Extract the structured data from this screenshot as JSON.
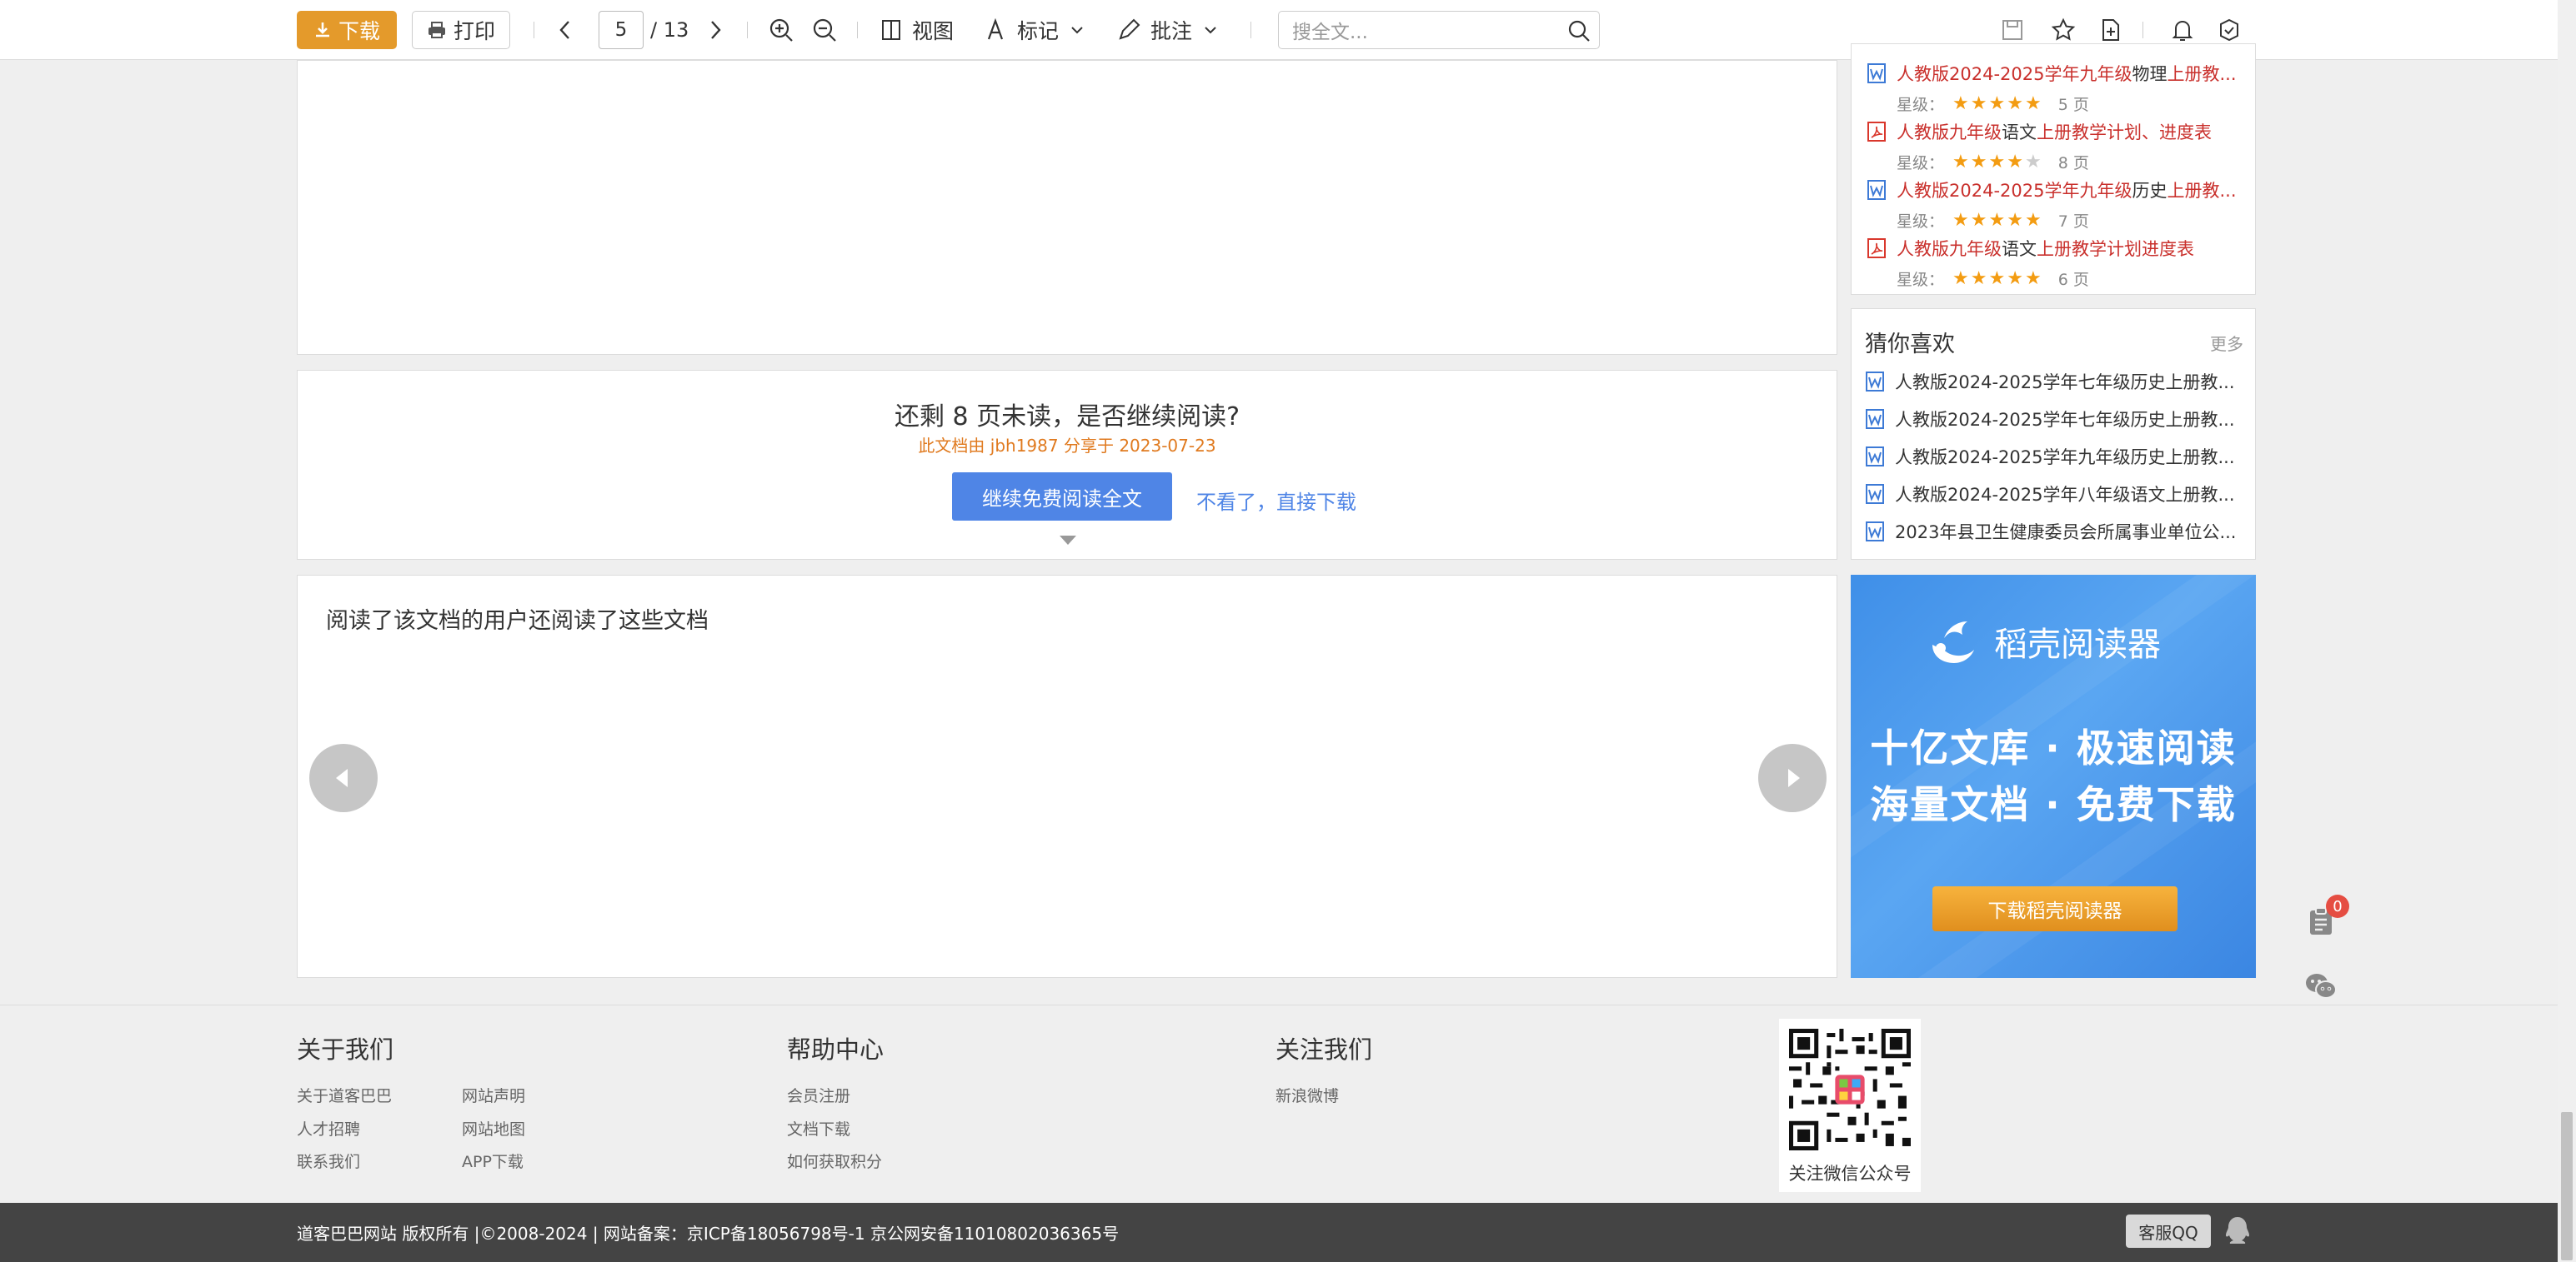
{
  "toolbar": {
    "download_label": "下载",
    "print_label": "打印",
    "current_page": "5",
    "total_pages": "/ 13",
    "view_label": "视图",
    "mark_label": "标记",
    "annotate_label": "批注",
    "search_placeholder": "搜全文..."
  },
  "continue_reading": {
    "title": "还剩 8 页未读，是否继续阅读?",
    "share_info": "此文档由 jbh1987 分享于 2023-07-23",
    "continue_button": "继续免费阅读全文",
    "direct_download": "不看了，直接下载"
  },
  "related": {
    "title": "阅读了该文档的用户还阅读了这些文档"
  },
  "recommended": [
    {
      "prefix": "人教版2024-2025学年九年级",
      "subject": "物理",
      "suffix": "上册教...",
      "type": "word",
      "stars": 5,
      "pages": "5 页",
      "rating_label": "星级："
    },
    {
      "prefix": "人教版九年级",
      "subject": "语文",
      "suffix": "上册教学计划、进度表",
      "type": "pdf",
      "stars": 4,
      "pages": "8 页",
      "rating_label": "星级："
    },
    {
      "prefix": "人教版2024-2025学年九年级",
      "subject": "历史",
      "suffix": "上册教...",
      "type": "word",
      "stars": 5,
      "pages": "7 页",
      "rating_label": "星级："
    },
    {
      "prefix": "人教版九年级",
      "subject": "语文",
      "suffix": "上册教学计划进度表",
      "type": "pdf",
      "stars": 5,
      "pages": "6 页",
      "rating_label": "星级："
    }
  ],
  "guess": {
    "title": "猜你喜欢",
    "more": "更多",
    "items": [
      "人教版2024-2025学年七年级历史上册教...",
      "人教版2024-2025学年七年级历史上册教...",
      "人教版2024-2025学年九年级历史上册教...",
      "人教版2024-2025学年八年级语文上册教...",
      "2023年县卫生健康委员会所属事业单位公..."
    ]
  },
  "ad": {
    "brand": "稻壳阅读器",
    "line1": "十亿文库 · 极速阅读",
    "line2": "海量文档 · 免费下载",
    "button": "下载稻壳阅读器"
  },
  "float_tools": {
    "badge_count": "0"
  },
  "footer": {
    "about": {
      "title": "关于我们",
      "links": [
        "关于道客巴巴",
        "网站声明",
        "人才招聘",
        "网站地图",
        "联系我们",
        "APP下载"
      ]
    },
    "help": {
      "title": "帮助中心",
      "links": [
        "会员注册",
        "文档下载",
        "如何获取积分"
      ]
    },
    "follow": {
      "title": "关注我们",
      "links": [
        "新浪微博"
      ]
    },
    "qr_caption": "关注微信公众号",
    "copyright": "道客巴巴网站 版权所有  |©2008-2024  |  网站备案：京ICP备18056798号-1  京公网安备11010802036365号",
    "qq_label": "客服QQ"
  },
  "colors": {
    "download_orange": "#e49a2b",
    "continue_blue": "#4f85e6",
    "title_red": "#c9302c",
    "star_orange": "#f39c12",
    "ad_blue": "#3f8fe8"
  }
}
